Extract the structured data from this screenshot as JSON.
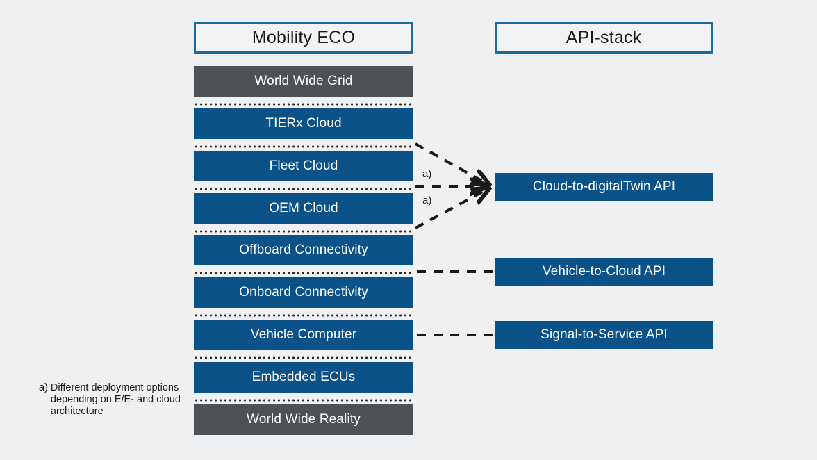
{
  "background_color": "#eff0f2",
  "colors": {
    "blue": "#0b5288",
    "gray": "#4e5257",
    "header_border": "#1b6ba3",
    "header_fill": "#f2f3f4",
    "connector": "#1a1a1a",
    "text_light": "#ffffff",
    "text_dark": "#1a1a1a"
  },
  "columns": {
    "left": {
      "header": "Mobility ECO",
      "layers": [
        {
          "label": "World Wide Grid",
          "style": "gray"
        },
        {
          "label": "TIERx Cloud",
          "style": "blue"
        },
        {
          "label": "Fleet Cloud",
          "style": "blue"
        },
        {
          "label": "OEM Cloud",
          "style": "blue"
        },
        {
          "label": "Offboard Connectivity",
          "style": "blue"
        },
        {
          "label": "Onboard Connectivity",
          "style": "blue"
        },
        {
          "label": "Vehicle Computer",
          "style": "blue"
        },
        {
          "label": "Embedded ECUs",
          "style": "blue"
        },
        {
          "label": "World Wide Reality",
          "style": "gray"
        }
      ]
    },
    "right": {
      "header": "API-stack",
      "apis": [
        {
          "label": "Cloud-to-digitalTwin API"
        },
        {
          "label": "Vehicle-to-Cloud API"
        },
        {
          "label": "Signal-to-Service API"
        }
      ]
    }
  },
  "connector_markers": {
    "fleet_cloud": "a)",
    "oem_cloud": "a)"
  },
  "footnote": {
    "marker": "a)",
    "text": "Different deployment options depending on E/E- and cloud architecture"
  }
}
